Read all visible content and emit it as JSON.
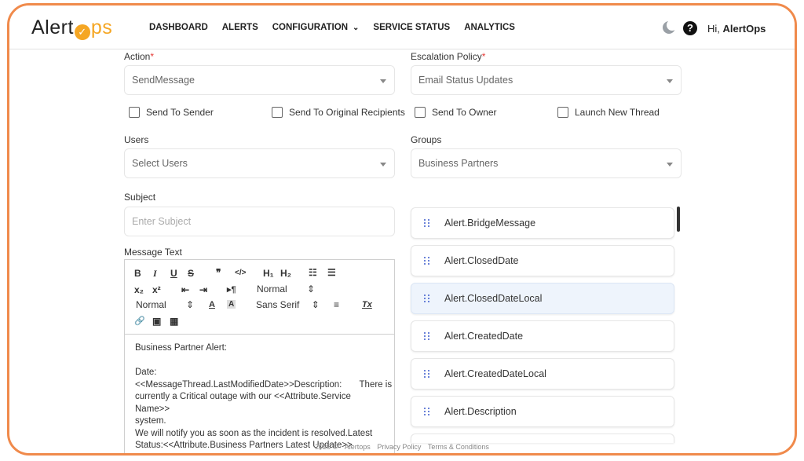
{
  "brand": {
    "logo_left": "Alert",
    "logo_mid": "✓",
    "logo_right": "ps",
    "accent": "#f5a623",
    "border": "#f08a4b"
  },
  "nav": [
    {
      "label": "DASHBOARD"
    },
    {
      "label": "ALERTS"
    },
    {
      "label": "CONFIGURATION"
    },
    {
      "label": "SERVICE STATUS"
    },
    {
      "label": "ANALYTICS"
    }
  ],
  "header": {
    "theme_icon": "moon-icon",
    "help_icon": "help-icon",
    "greeting": "Hi,",
    "user": "AlertOps"
  },
  "form": {
    "action_label": "Action",
    "action_value": "SendMessage",
    "escalation_label": "Escalation Policy",
    "escalation_value": "Email Status Updates",
    "checkboxes": [
      "Send To Sender",
      "Send To Original Recipients",
      "Send To Owner",
      "Launch New Thread"
    ],
    "users_label": "Users",
    "users_placeholder": "Select Users",
    "groups_label": "Groups",
    "groups_value": "Business Partners",
    "subject_label": "Subject",
    "subject_placeholder": "Enter Subject",
    "message_label": "Message Text",
    "required_mark": "*"
  },
  "editor": {
    "toolbar": {
      "bold": "B",
      "italic": "I",
      "underline": "U",
      "strike": "S",
      "quote": "❞",
      "code": "</>",
      "h1": "H₁",
      "h2": "H₂",
      "ordered": "☷",
      "bullet": "☰",
      "sub": "x₂",
      "sup": "x²",
      "outdent": "⇤",
      "indent": "⇥",
      "rtl": "▸¶",
      "header_select": "Normal",
      "size_select": "Normal",
      "color": "A",
      "background": "A",
      "font_select": "Sans Serif",
      "align": "≡",
      "clear": "Tx",
      "link": "🔗",
      "image": "▣",
      "video": "▦"
    },
    "lines": [
      "Business Partner Alert:",
      "",
      "Date:",
      "<<MessageThread.LastModifiedDate>>Description:       There is",
      "currently a Critical outage with our <<Attribute.Service Name>>",
      "system.",
      "We will notify you as soon as the incident is resolved.Latest",
      "Status:<<Attribute.Business Partners Latest Update>>"
    ]
  },
  "variables": [
    "Alert.BridgeMessage",
    "Alert.ClosedDate",
    "Alert.ClosedDateLocal",
    "Alert.CreatedDate",
    "Alert.CreatedDateLocal",
    "Alert.Description",
    ""
  ],
  "footer": {
    "copyright": "2025 ©",
    "company": "Alertops",
    "privacy": "Privacy Policy",
    "terms": "Terms & Conditions"
  }
}
